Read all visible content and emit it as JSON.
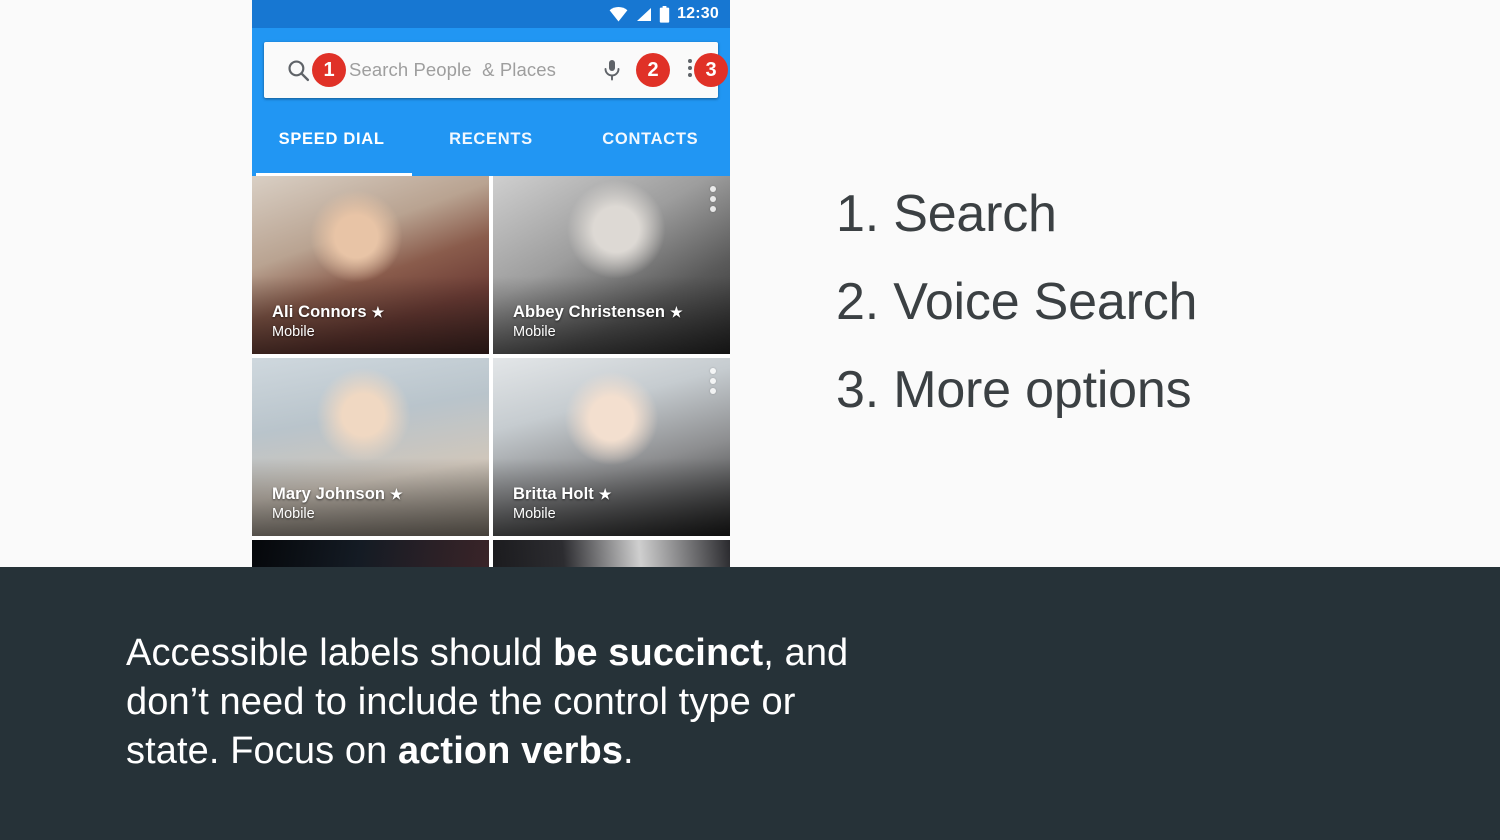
{
  "theme": {
    "page_background": "#fafafa",
    "status_bar_blue": "#1777d2",
    "app_bar_blue": "#2196f3",
    "badge_red": "#e03127",
    "caption_band": "#263238",
    "legend_text": "#3b4043"
  },
  "phone": {
    "status_bar": {
      "time": "12:30",
      "icons": [
        "wifi-icon",
        "cellular-signal-icon",
        "battery-icon"
      ]
    },
    "search": {
      "placeholder": "Search People  & Places",
      "search_icon": "search-icon",
      "mic_icon": "microphone-icon",
      "overflow_icon": "more-vert-icon",
      "callouts": [
        {
          "number": "1",
          "target": "search-icon"
        },
        {
          "number": "2",
          "target": "microphone-icon"
        },
        {
          "number": "3",
          "target": "more-vert-icon"
        }
      ]
    },
    "tabs": [
      {
        "label": "SPEED DIAL",
        "active": true
      },
      {
        "label": "RECENTS",
        "active": false
      },
      {
        "label": "CONTACTS",
        "active": false
      }
    ],
    "contacts": [
      {
        "name": "Ali Connors",
        "subtitle": "Mobile",
        "starred": true,
        "star": "★",
        "menu": false
      },
      {
        "name": "Abbey Christensen",
        "subtitle": "Mobile",
        "starred": true,
        "star": "★",
        "menu": true
      },
      {
        "name": "Mary Johnson",
        "subtitle": "Mobile",
        "starred": true,
        "star": "★",
        "menu": false
      },
      {
        "name": "Britta Holt",
        "subtitle": "Mobile",
        "starred": true,
        "star": "★",
        "menu": true
      }
    ]
  },
  "legend": {
    "items": [
      "1. Search",
      "2. Voice Search",
      "3. More options"
    ]
  },
  "caption": {
    "line1_a": "Accessible labels should ",
    "line1_b": "be succinct",
    "line1_c": ", and",
    "line2": "don’t need to include the control type or",
    "line3_a": "state. Focus on ",
    "line3_b": "action verbs",
    "line3_c": "."
  }
}
